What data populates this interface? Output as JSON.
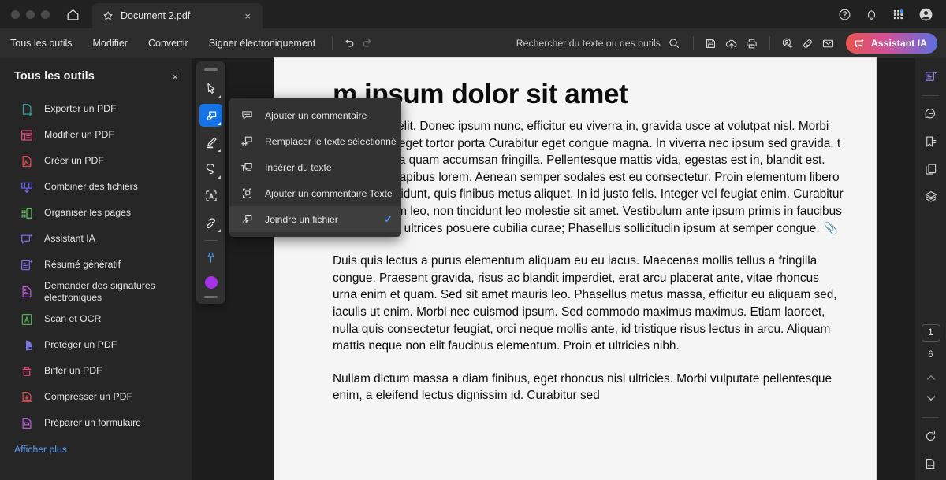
{
  "window": {
    "traffic_lights": [
      "close",
      "minimize",
      "maximize"
    ],
    "home_icon": "home-icon",
    "tab": {
      "star_icon": "star-icon",
      "title": "Document 2.pdf",
      "close": "×"
    },
    "right_icons": [
      "help-icon",
      "bell-icon",
      "apps-grid-icon",
      "account-avatar-icon"
    ]
  },
  "menubar": {
    "items": [
      {
        "label": "Tous les outils"
      },
      {
        "label": "Modifier"
      },
      {
        "label": "Convertir"
      },
      {
        "label": "Signer électroniquement"
      }
    ],
    "undo_icon": "undo-icon",
    "redo_icon": "redo-icon",
    "search": {
      "placeholder": "Rechercher du texte ou des outils",
      "icon": "search-icon"
    },
    "tools": [
      "save-icon",
      "cloud-upload-icon",
      "print-icon",
      "add-person-icon",
      "link-icon",
      "mail-icon"
    ],
    "assistant": {
      "label": "Assistant IA",
      "icon": "ai-assistant-icon"
    }
  },
  "sidebar": {
    "title": "Tous les outils",
    "close": "×",
    "items": [
      {
        "label": "Exporter un PDF",
        "icon": "export-pdf-icon",
        "color": "#2aa79b"
      },
      {
        "label": "Modifier un PDF",
        "icon": "edit-pdf-icon",
        "color": "#e0487f"
      },
      {
        "label": "Créer un PDF",
        "icon": "create-pdf-icon",
        "color": "#e0484c"
      },
      {
        "label": "Combiner des fichiers",
        "icon": "combine-files-icon",
        "color": "#6a63e8"
      },
      {
        "label": "Organiser les pages",
        "icon": "organize-pages-icon",
        "color": "#5fc45f"
      },
      {
        "label": "Assistant IA",
        "icon": "ai-assistant-icon",
        "color": "#7a6ae8"
      },
      {
        "label": "Résumé génératif",
        "icon": "generative-summary-icon",
        "color": "#7a6ae8"
      },
      {
        "label": "Demander des signatures électroniques",
        "icon": "request-signatures-icon",
        "color": "#b558d6"
      },
      {
        "label": "Scan et OCR",
        "icon": "scan-ocr-icon",
        "color": "#4fae4f"
      },
      {
        "label": "Protéger un PDF",
        "icon": "protect-pdf-icon",
        "color": "#7a7ae0"
      },
      {
        "label": "Biffer un PDF",
        "icon": "redact-pdf-icon",
        "color": "#e0487f"
      },
      {
        "label": "Compresser un PDF",
        "icon": "compress-pdf-icon",
        "color": "#e0484c"
      },
      {
        "label": "Préparer un formulaire",
        "icon": "prepare-form-icon",
        "color": "#b558d6"
      }
    ],
    "show_more": "Afficher plus"
  },
  "floating_toolbar": {
    "tools": [
      {
        "name": "select-tool",
        "icon": "cursor-arrow-icon",
        "active": false,
        "has_caret": true
      },
      {
        "name": "comment-tool",
        "icon": "attach-comment-icon",
        "active": true,
        "has_caret": true
      },
      {
        "name": "highlight-tool",
        "icon": "highlighter-pen-icon",
        "active": false,
        "has_caret": true
      },
      {
        "name": "draw-tool",
        "icon": "freehand-lasso-icon",
        "active": false,
        "has_caret": true
      },
      {
        "name": "text-select-tool",
        "icon": "select-text-box-icon",
        "active": false,
        "has_caret": false
      },
      {
        "name": "erase-tool",
        "icon": "eraser-stamp-icon",
        "active": false,
        "has_caret": true
      }
    ],
    "pin": {
      "name": "pushpin-icon",
      "color": "#4a9bf0"
    },
    "color_swatch": "#a633e8"
  },
  "context_menu": {
    "items": [
      {
        "label": "Ajouter un commentaire",
        "icon": "comment-bubble-icon",
        "checked": false
      },
      {
        "label": "Remplacer le texte sélectionné",
        "icon": "replace-text-icon",
        "checked": false
      },
      {
        "label": "Insérer du texte",
        "icon": "insert-text-icon",
        "checked": false
      },
      {
        "label": "Ajouter un commentaire Texte",
        "icon": "text-box-comment-icon",
        "checked": false
      },
      {
        "label": "Joindre un fichier",
        "icon": "attach-file-icon",
        "checked": true
      }
    ],
    "check_mark": "✓"
  },
  "document": {
    "heading": "m ipsum dolor sit amet",
    "paragraphs": [
      "r adipiscing elit. Donec ipsum nunc, efficitur eu viverra in, gravida usce at volutpat nisl. Morbi porttitor nisl eget tortor porta Curabitur eget congue magna. In viverra nec ipsum sed gravida. t amet ipsum a quam accumsan fringilla. Pellentesque mattis vida, egestas est in, blandit est. Fusce non dapibus lorem. Aenean semper sodales est eu consectetur. Proin elementum libero ut ipsum tincidunt, quis finibus metus aliquet. In id justo felis. Integer vel feugiat enim. Curabitur vehicula enim leo, non tincidunt leo molestie sit amet. Vestibulum ante ipsum primis in faucibus orci luctus et ultrices posuere cubilia curae; Phasellus sollicitudin ipsum at semper congue.",
      "Duis quis lectus a purus elementum aliquam eu eu lacus. Maecenas mollis tellus a fringilla congue. Praesent gravida, risus ac blandit imperdiet, erat arcu placerat ante, vitae rhoncus urna enim et quam. Sed sit amet mauris leo. Phasellus metus massa, efficitur eu aliquam sed, iaculis ut enim. Morbi nec euismod ipsum. Sed commodo maximus maximus. Etiam laoreet, nulla quis consectetur feugiat, orci neque mollis ante, id tristique risus lectus in arcu. Aliquam mattis neque non elit faucibus elementum. Proin et ultricies nibh.",
      "Nullam dictum massa a diam finibus, eget rhoncus nisl ultricies. Morbi vulputate pellentesque enim, a eleifend lectus dignissim id. Curabitur sed"
    ],
    "attachment_icon": "📎"
  },
  "right_rail": {
    "top_icons": [
      {
        "name": "generative-summary-icon",
        "color": "#8f86e8"
      },
      {
        "name": "comments-panel-icon",
        "color": "#d6d6d6"
      },
      {
        "name": "bookmarks-panel-icon",
        "color": "#d6d6d6"
      },
      {
        "name": "page-thumbnails-icon",
        "color": "#d6d6d6"
      },
      {
        "name": "layers-panel-icon",
        "color": "#d6d6d6"
      }
    ],
    "current_page": "1",
    "total_pages": "6",
    "prev_icon": "chevron-up-icon",
    "next_icon": "chevron-down-icon",
    "rotate_icon": "rotate-icon",
    "fit_icon": "fit-page-icon"
  },
  "colors": {
    "accent_blue": "#1473e6",
    "link_blue": "#5b9bf5",
    "swatch_purple": "#a633e8",
    "titlebar_bg": "#212121",
    "toolbar_bg": "#2d2d2d",
    "panel_bg": "#262626",
    "page_bg": "#f5f5f5"
  }
}
